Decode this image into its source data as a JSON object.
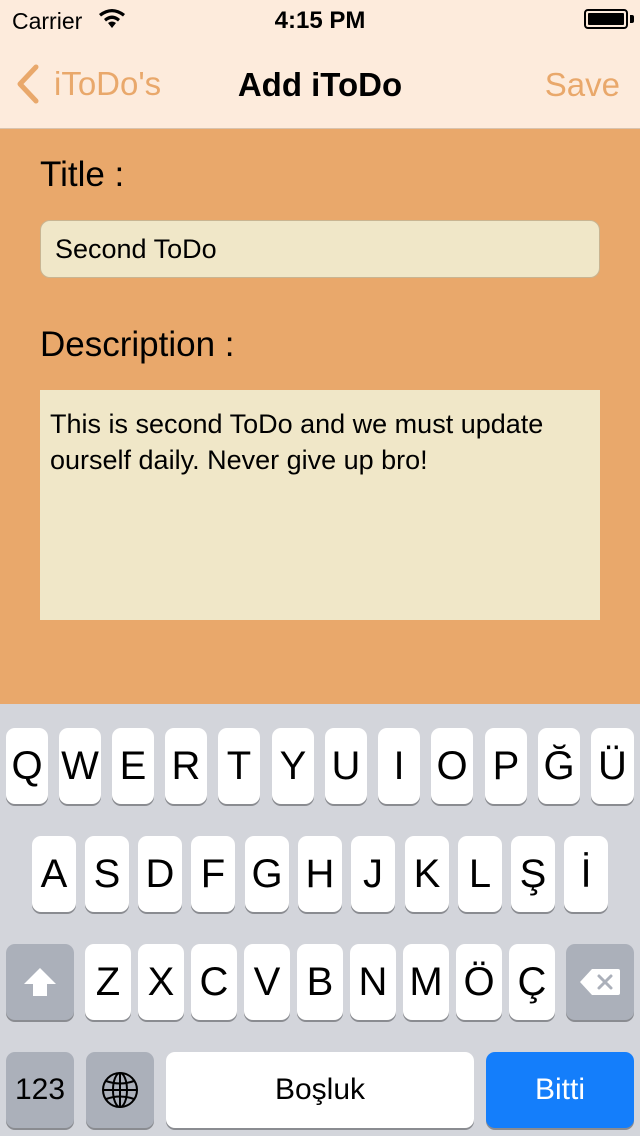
{
  "status": {
    "carrier": "Carrier",
    "time": "4:15 PM"
  },
  "nav": {
    "back_label": "iToDo's",
    "title": "Add iToDo",
    "save_label": "Save"
  },
  "form": {
    "title_label": "Title :",
    "title_value": "Second ToDo",
    "description_label": "Description :",
    "description_value": "This is second ToDo and we must update ourself daily. Never give up bro!"
  },
  "keyboard": {
    "row1": [
      "Q",
      "W",
      "E",
      "R",
      "T",
      "Y",
      "U",
      "I",
      "O",
      "P",
      "Ğ",
      "Ü"
    ],
    "row2": [
      "A",
      "S",
      "D",
      "F",
      "G",
      "H",
      "J",
      "K",
      "L",
      "Ş",
      "İ"
    ],
    "row3": [
      "Z",
      "X",
      "C",
      "V",
      "B",
      "N",
      "M",
      "Ö",
      "Ç"
    ],
    "numbers_label": "123",
    "space_label": "Boşluk",
    "done_label": "Bitti"
  },
  "colors": {
    "accent": "#E9A86B",
    "navbar": "#FDEBDC",
    "field": "#F0E7C8",
    "done_key": "#147EFB"
  }
}
